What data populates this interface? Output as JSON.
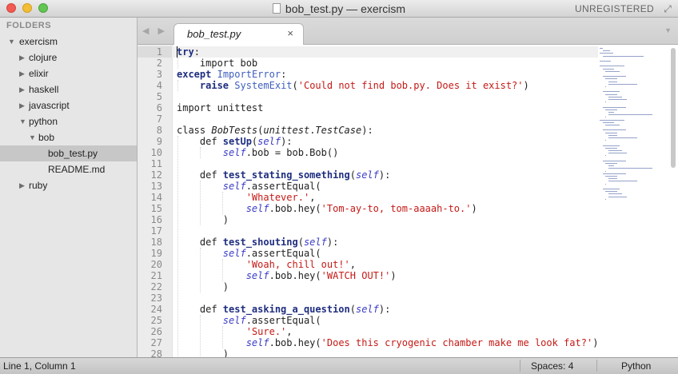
{
  "window": {
    "title": "bob_test.py — exercism",
    "registration": "UNREGISTERED"
  },
  "sidebar": {
    "header": "FOLDERS",
    "items": [
      {
        "label": "exercism",
        "expanded": true
      },
      {
        "label": "clojure",
        "expanded": false
      },
      {
        "label": "elixir",
        "expanded": false
      },
      {
        "label": "haskell",
        "expanded": false
      },
      {
        "label": "javascript",
        "expanded": false
      },
      {
        "label": "python",
        "expanded": true
      },
      {
        "label": "bob",
        "expanded": true
      },
      {
        "label": "bob_test.py",
        "selected": true
      },
      {
        "label": "README.md"
      },
      {
        "label": "ruby",
        "expanded": false
      }
    ]
  },
  "tabs": [
    {
      "label": "bob_test.py",
      "active": true,
      "close_glyph": "×"
    }
  ],
  "editor": {
    "line_numbers": [
      "1",
      "2",
      "3",
      "4",
      "5",
      "6",
      "7",
      "8",
      "9",
      "10",
      "11",
      "12",
      "13",
      "14",
      "15",
      "16",
      "17",
      "18",
      "19",
      "20",
      "21",
      "22",
      "23",
      "24",
      "25",
      "26",
      "27",
      "28"
    ],
    "lines": [
      "try:",
      "    import bob",
      "except ImportError:",
      "    raise SystemExit('Could not find bob.py. Does it exist?')",
      "",
      "import unittest",
      "",
      "class BobTests(unittest.TestCase):",
      "    def setUp(self):",
      "        self.bob = bob.Bob()",
      "",
      "    def test_stating_something(self):",
      "        self.assertEqual(",
      "            'Whatever.',",
      "            self.bob.hey('Tom-ay-to, tom-aaaah-to.')",
      "        )",
      "",
      "    def test_shouting(self):",
      "        self.assertEqual(",
      "            'Woah, chill out!',",
      "            self.bob.hey('WATCH OUT!')",
      "        )",
      "",
      "    def test_asking_a_question(self):",
      "        self.assertEqual(",
      "            'Sure.',",
      "            self.bob.hey('Does this cryogenic chamber make me look fat?')",
      "        )"
    ]
  },
  "status": {
    "position": "Line 1, Column 1",
    "indentation": "Spaces: 4",
    "syntax": "Python"
  },
  "colors": {
    "keyword": "#1f2e80",
    "string": "#c41a16",
    "self": "#3a3ac8",
    "class_name": "#3f5fbf"
  }
}
